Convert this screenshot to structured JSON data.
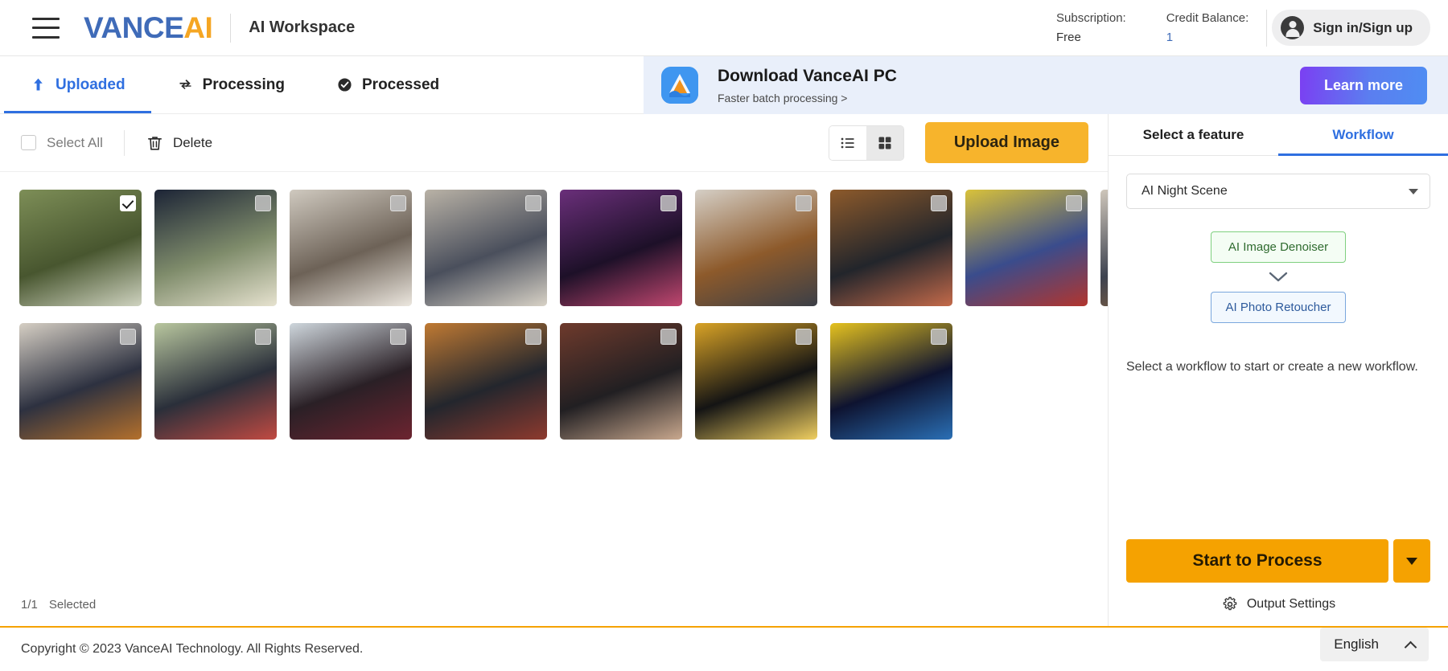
{
  "header": {
    "menu_icon": "hamburger-menu-icon",
    "logo_primary": "VANCE",
    "logo_accent": "AI",
    "workspace_title": "AI Workspace",
    "subscription_label": "Subscription:",
    "subscription_value": "Free",
    "credit_label": "Credit Balance:",
    "credit_value": "1",
    "signin_label": "Sign in/Sign up",
    "account_icon": "user-avatar-icon",
    "accent_blue": "#3f6bb8",
    "accent_orange": "#f5a623"
  },
  "tabs": [
    {
      "label": "Uploaded",
      "icon": "upload-arrow-icon",
      "active": true
    },
    {
      "label": "Processing",
      "icon": "refresh-sync-icon",
      "active": false
    },
    {
      "label": "Processed",
      "icon": "check-circle-icon",
      "active": false
    }
  ],
  "promo": {
    "icon": "vanceai-app-icon",
    "title": "Download VanceAI PC",
    "subtitle": "Faster batch processing >",
    "button_label": "Learn more",
    "gradient_start": "#7b3ff2",
    "gradient_end": "#4f8df2"
  },
  "toolbar": {
    "select_all_label": "Select All",
    "select_all_checked": false,
    "delete_label": "Delete",
    "delete_icon": "trash-icon",
    "list_view_icon": "list-view-icon",
    "grid_view_icon": "grid-view-icon",
    "active_view": "grid",
    "upload_label": "Upload Image",
    "upload_color": "#f7b42c"
  },
  "gallery": {
    "status_count": "1/1",
    "status_label": "Selected",
    "items": [
      {
        "name": "yoga-in-park",
        "selected": true,
        "c1": "#7d8e57",
        "c2": "#48562f",
        "c3": "#cfd3c0"
      },
      {
        "name": "man-by-tree-portrait",
        "selected": false,
        "c1": "#1c2436",
        "c2": "#7f8c6b",
        "c3": "#e6e2cf"
      },
      {
        "name": "classroom-group",
        "selected": false,
        "c1": "#cfc9bf",
        "c2": "#6d6257",
        "c3": "#ece7df"
      },
      {
        "name": "lecture-hall-discussion",
        "selected": false,
        "c1": "#b9b2a6",
        "c2": "#4a4f5c",
        "c3": "#d8d2c6"
      },
      {
        "name": "concert-crowd-purple",
        "selected": false,
        "c1": "#6a2f7a",
        "c2": "#1d1028",
        "c3": "#c0476f"
      },
      {
        "name": "students-hallway-chat",
        "selected": false,
        "c1": "#d5cfc6",
        "c2": "#8d5a2b",
        "c3": "#3b3f47"
      },
      {
        "name": "graduation-ceremony",
        "selected": false,
        "c1": "#8d5a2b",
        "c2": "#22252b",
        "c3": "#c46a4a"
      },
      {
        "name": "woman-red-top-flowers",
        "selected": false,
        "c1": "#d9c23a",
        "c2": "#3a4c8c",
        "c3": "#b2352e"
      },
      {
        "name": "group-conversation-lobby",
        "selected": false,
        "c1": "#cfc7bb",
        "c2": "#3e4350",
        "c3": "#9a6a3a"
      },
      {
        "name": "students-orange-dress",
        "selected": false,
        "c1": "#d6cfc4",
        "c2": "#2d3140",
        "c3": "#b4702c"
      },
      {
        "name": "outdoor-table-pair",
        "selected": false,
        "c1": "#b9c79f",
        "c2": "#2a2f3a",
        "c3": "#c14a42"
      },
      {
        "name": "two-students-portrait",
        "selected": false,
        "c1": "#cfd7dd",
        "c2": "#2a2026",
        "c3": "#6d2430"
      },
      {
        "name": "graduates-autumn-leaves",
        "selected": false,
        "c1": "#c07a33",
        "c2": "#23262d",
        "c3": "#8e3a2e"
      },
      {
        "name": "friends-brick-wall",
        "selected": false,
        "c1": "#6e3a2c",
        "c2": "#211f22",
        "c3": "#c9a88e"
      },
      {
        "name": "golden-dragon-statue",
        "selected": false,
        "c1": "#d9a326",
        "c2": "#141414",
        "c3": "#f0cf61"
      },
      {
        "name": "stained-glass-madonna",
        "selected": false,
        "c1": "#e5c21f",
        "c2": "#0e1330",
        "c3": "#2a6fb5"
      }
    ]
  },
  "panel": {
    "tabs": [
      {
        "label": "Select a feature",
        "active": false
      },
      {
        "label": "Workflow",
        "active": true
      }
    ],
    "workflow_select_value": "AI Night Scene",
    "workflow_nodes": [
      {
        "label": "AI Image Denoiser",
        "style": "green"
      },
      {
        "label": "AI Photo Retoucher",
        "style": "blue"
      }
    ],
    "flow_arrow_icon": "chevron-down-icon",
    "hint": "Select a workflow to start or create a new workflow.",
    "process_label": "Start to Process",
    "process_caret_icon": "caret-down-icon",
    "output_settings_label": "Output Settings",
    "output_settings_icon": "gear-icon",
    "process_color": "#f5a201"
  },
  "footer": {
    "copyright": "Copyright © 2023 VanceAI Technology. All Rights Reserved.",
    "language": "English",
    "language_caret_icon": "chevron-up-icon",
    "accent": "#f5a201"
  }
}
